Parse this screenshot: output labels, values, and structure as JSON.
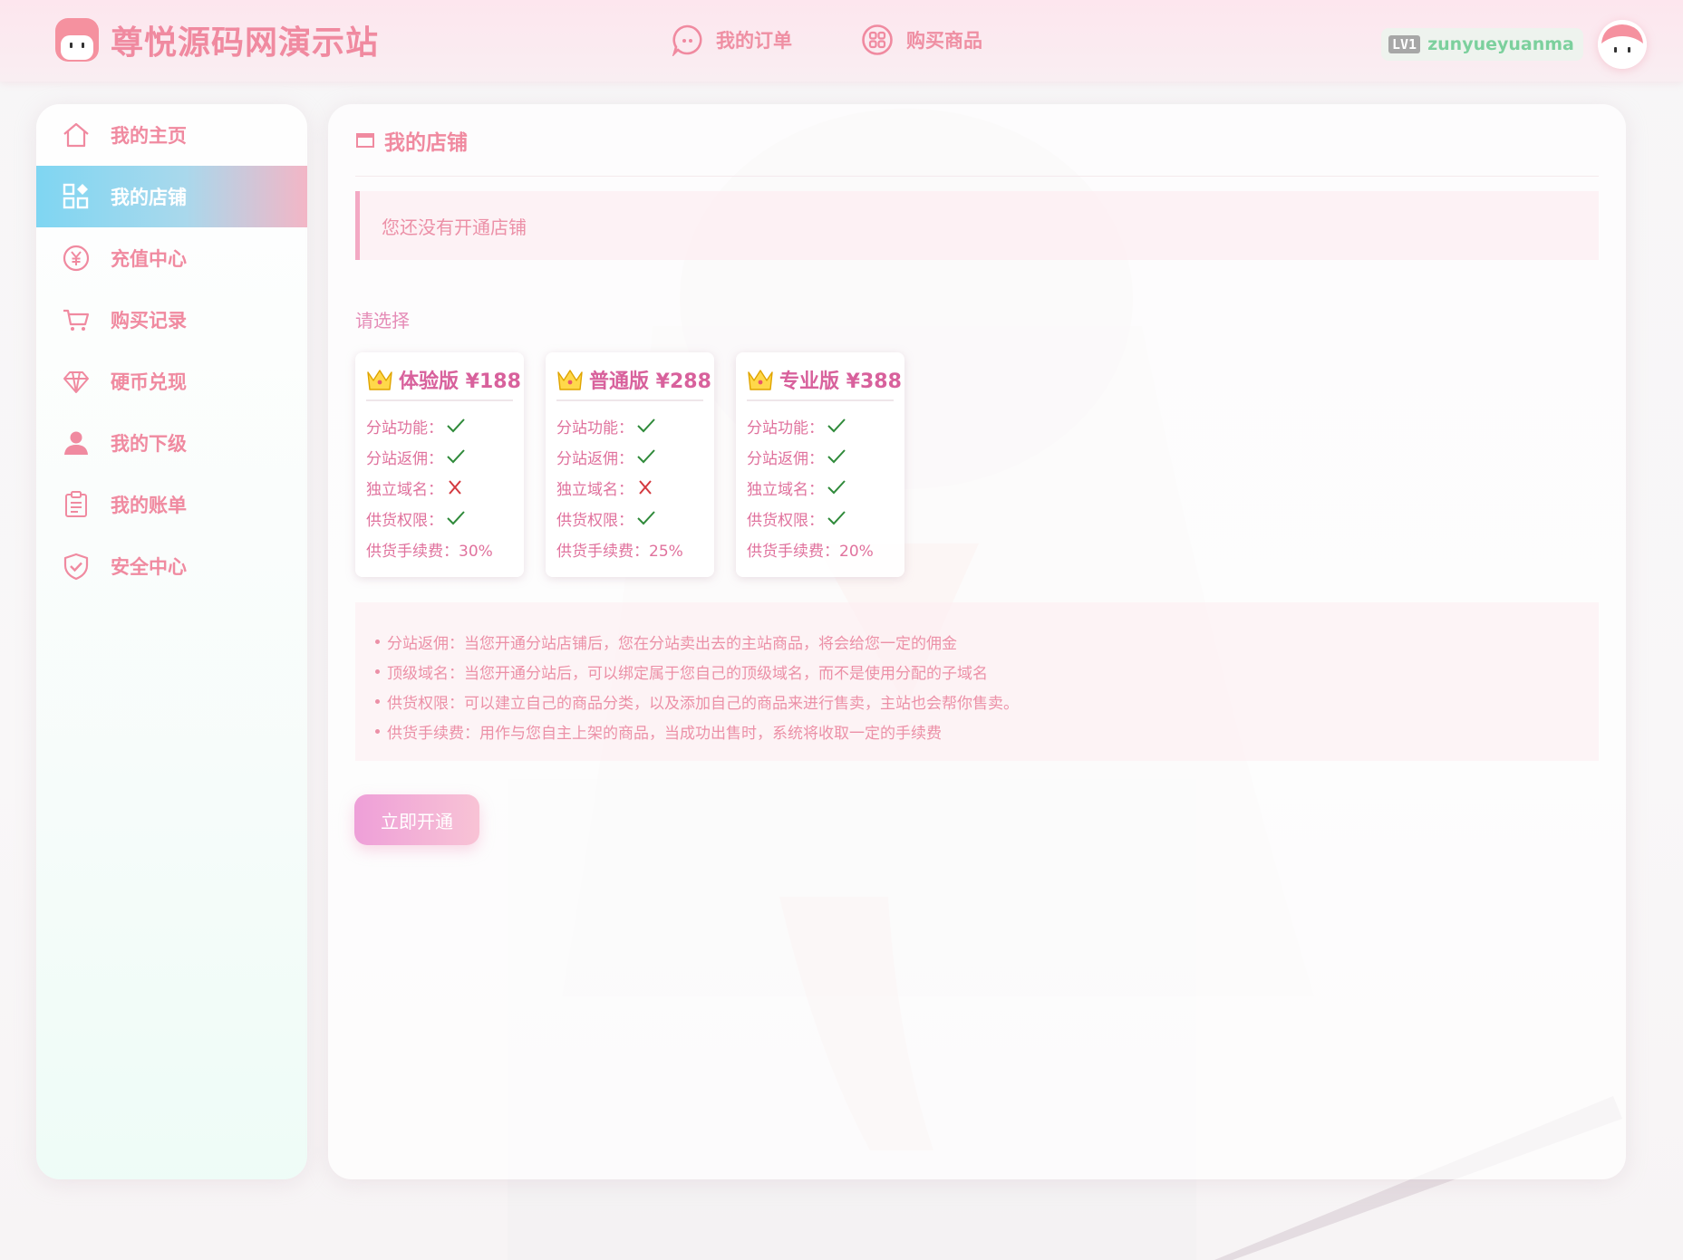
{
  "header": {
    "site_title": "尊悦源码网演示站",
    "logo_icon": "mascot-logo-icon",
    "nav": [
      {
        "label": "我的订单",
        "icon": "chat-bubble-icon"
      },
      {
        "label": "购买商品",
        "icon": "apps-grid-icon"
      }
    ],
    "user": {
      "level": "LV1",
      "username": "zunyueyuanma",
      "avatar_icon": "mascot-avatar-icon"
    }
  },
  "sidebar": {
    "items": [
      {
        "label": "我的主页",
        "icon": "home-icon",
        "active": false
      },
      {
        "label": "我的店铺",
        "icon": "shop-grid-icon",
        "active": true
      },
      {
        "label": "充值中心",
        "icon": "yuan-coin-icon",
        "active": false
      },
      {
        "label": "购买记录",
        "icon": "cart-icon",
        "active": false
      },
      {
        "label": "硬币兑现",
        "icon": "diamond-icon",
        "active": false
      },
      {
        "label": "我的下级",
        "icon": "user-icon",
        "active": false
      },
      {
        "label": "我的账单",
        "icon": "clipboard-icon",
        "active": false
      },
      {
        "label": "安全中心",
        "icon": "shield-check-icon",
        "active": false
      }
    ]
  },
  "main": {
    "title": "我的店铺",
    "alert": "您还没有开通店铺",
    "choose_label": "请选择",
    "plans": [
      {
        "name": "体验版 ¥188",
        "features": [
          {
            "label": "分站功能：",
            "ok": true
          },
          {
            "label": "分站返佣：",
            "ok": true
          },
          {
            "label": "独立域名：",
            "ok": false
          },
          {
            "label": "供货权限：",
            "ok": true
          }
        ],
        "fee_label": "供货手续费：30%"
      },
      {
        "name": "普通版 ¥288",
        "features": [
          {
            "label": "分站功能：",
            "ok": true
          },
          {
            "label": "分站返佣：",
            "ok": true
          },
          {
            "label": "独立域名：",
            "ok": false
          },
          {
            "label": "供货权限：",
            "ok": true
          }
        ],
        "fee_label": "供货手续费：25%"
      },
      {
        "name": "专业版 ¥388",
        "features": [
          {
            "label": "分站功能：",
            "ok": true
          },
          {
            "label": "分站返佣：",
            "ok": true
          },
          {
            "label": "独立域名：",
            "ok": true
          },
          {
            "label": "供货权限：",
            "ok": true
          }
        ],
        "fee_label": "供货手续费：20%"
      }
    ],
    "notes": [
      "分站返佣：当您开通分站店铺后，您在分站卖出去的主站商品，将会给您一定的佣金",
      "顶级域名：当您开通分站后，可以绑定属于您自己的顶级域名，而不是使用分配的子域名",
      "供货权限：可以建立自己的商品分类，以及添加自己的商品来进行售卖，主站也会帮你售卖。",
      "供货手续费：用作与您自主上架的商品，当成功出售时，系统将收取一定的手续费"
    ],
    "open_button": "立即开通"
  },
  "colors": {
    "accent": "#f08aa0",
    "plan_title": "#d8619c",
    "check": "#2f8a3a",
    "cross": "#d4393f",
    "active_gradient_start": "#7fd6f2",
    "active_gradient_end": "#f3b6c6"
  }
}
